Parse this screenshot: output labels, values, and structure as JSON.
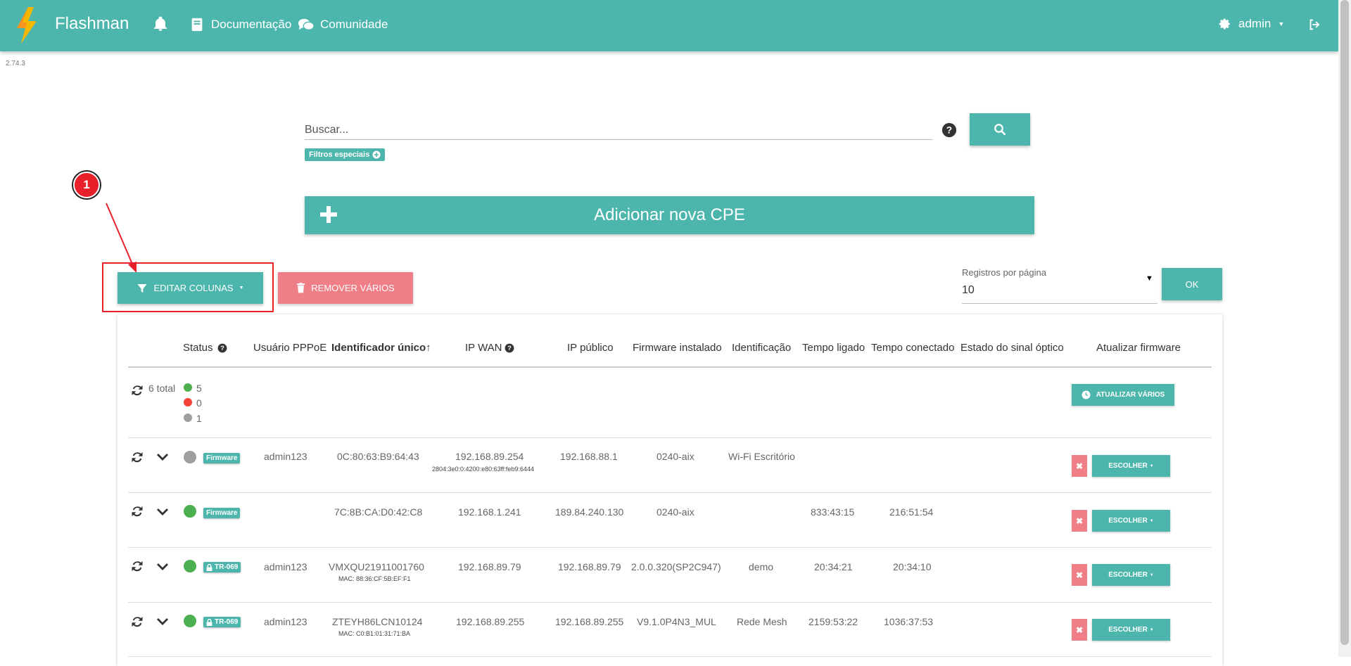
{
  "app": {
    "title": "Flashman",
    "version": "2.74.3"
  },
  "nav": {
    "docs_label": "Documentação",
    "community_label": "Comunidade",
    "user_label": "admin"
  },
  "search": {
    "placeholder": "Buscar...",
    "special_filters_label": "Filtros especiais"
  },
  "add_cpe_label": "Adicionar nova CPE",
  "annotation": {
    "number": "1"
  },
  "toolbar": {
    "edit_columns_label": "EDITAR COLUNAS",
    "remove_many_label": "REMOVER VÁRIOS",
    "records_per_page_label": "Registros por página",
    "records_per_page_value": "10",
    "ok_label": "OK"
  },
  "table": {
    "headers": {
      "status": "Status",
      "pppoe_user": "Usuário PPPoE",
      "unique_id": "Identificador único↑",
      "ip_wan": "IP WAN",
      "public_ip": "IP público",
      "firmware": "Firmware instalado",
      "identification": "Identificação",
      "uptime": "Tempo ligado",
      "connected_time": "Tempo conectado",
      "optical_signal": "Estado do sinal óptico",
      "update_firmware": "Atualizar firmware"
    },
    "summary": {
      "total": "6 total",
      "online": "5",
      "offline": "0",
      "unknown": "1",
      "update_many_label": "ATUALIZAR VÁRIOS"
    },
    "choose_label": "ESCOLHER",
    "status_colors": {
      "online": "#4caf50",
      "offline": "#f44336",
      "unknown": "#9e9e9e"
    },
    "rows": [
      {
        "status": "unknown",
        "tag": "Firmware",
        "tag_lock": false,
        "user": "admin123",
        "id": "0C:80:63:B9:64:43",
        "id_sub": "",
        "ip_wan": "192.168.89.254",
        "ip_wan_sub": "2804:3e0:0:4200:e80:63ff:feb9:6444",
        "public_ip": "192.168.88.1",
        "firmware": "0240-aix",
        "identification": "Wi-Fi Escritório",
        "uptime": "",
        "connected": ""
      },
      {
        "status": "online",
        "tag": "Firmware",
        "tag_lock": false,
        "user": "",
        "id": "7C:8B:CA:D0:42:C8",
        "id_sub": "",
        "ip_wan": "192.168.1.241",
        "ip_wan_sub": "",
        "public_ip": "189.84.240.130",
        "firmware": "0240-aix",
        "identification": "",
        "uptime": "833:43:15",
        "connected": "216:51:54"
      },
      {
        "status": "online",
        "tag": "TR-069",
        "tag_lock": true,
        "user": "admin123",
        "id": "VMXQU21911001760",
        "id_sub": "MAC: 88:36:CF:5B:EF:F1",
        "ip_wan": "192.168.89.79",
        "ip_wan_sub": "",
        "public_ip": "192.168.89.79",
        "firmware": "2.0.0.320(SP2C947)",
        "identification": "demo",
        "uptime": "20:34:21",
        "connected": "20:34:10"
      },
      {
        "status": "online",
        "tag": "TR-069",
        "tag_lock": true,
        "user": "admin123",
        "id": "ZTEYH86LCN10124",
        "id_sub": "MAC: C0:B1:01:31:71:BA",
        "ip_wan": "192.168.89.255",
        "ip_wan_sub": "",
        "public_ip": "192.168.89.255",
        "firmware": "V9.1.0P4N3_MUL",
        "identification": "Rede Mesh",
        "uptime": "2159:53:22",
        "connected": "1036:37:53"
      }
    ]
  }
}
